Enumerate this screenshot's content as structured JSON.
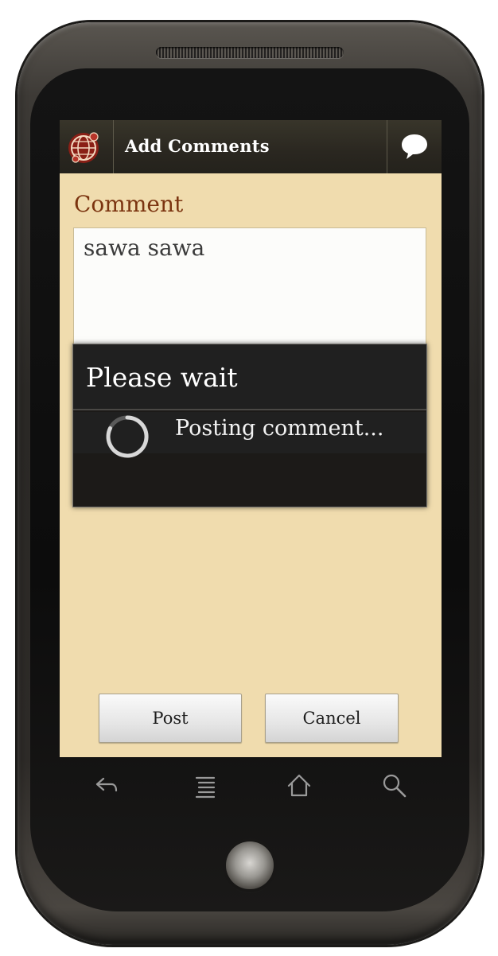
{
  "app": {
    "title": "Add Comments",
    "logo_icon": "globe-logo-icon",
    "action_icon": "speech-bubble-icon"
  },
  "form": {
    "label": "Comment",
    "comment_value": "sawa sawa"
  },
  "buttons": {
    "post": "Post",
    "cancel": "Cancel"
  },
  "dialog": {
    "title": "Please wait",
    "message": "Posting comment..."
  },
  "navigation": {
    "keys": [
      "back-icon",
      "menu-icon",
      "home-icon",
      "search-icon"
    ]
  },
  "colors": {
    "screen_background": "#f0dcae",
    "label_color": "#7b3410",
    "action_bar": "#2a2720"
  }
}
